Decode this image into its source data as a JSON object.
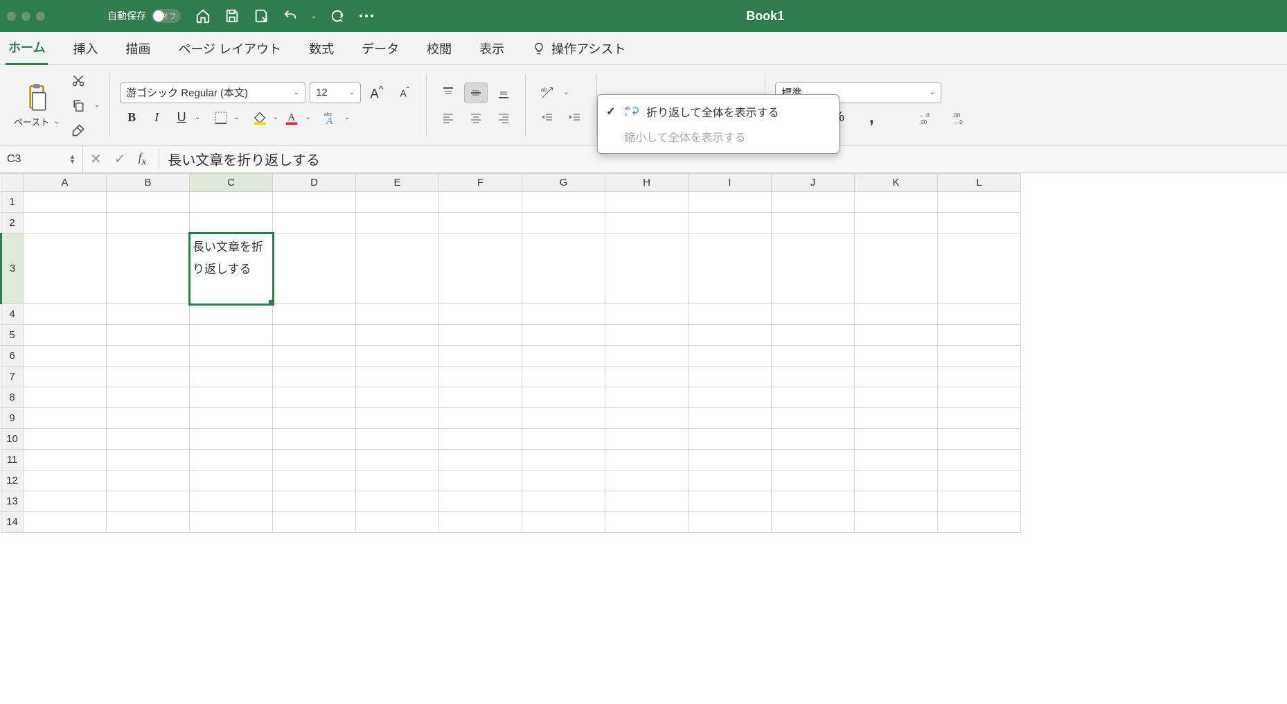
{
  "titlebar": {
    "autosave_label": "自動保存",
    "autosave_toggle": "オフ",
    "title": "Book1"
  },
  "tabs": [
    "ホーム",
    "挿入",
    "描画",
    "ページ レイアウト",
    "数式",
    "データ",
    "校閲",
    "表示"
  ],
  "assist": {
    "label": "操作アシスト"
  },
  "ribbon": {
    "paste_label": "ペースト",
    "font_name": "游ゴシック Regular (本文)",
    "font_size": "12",
    "wrap_label": "折り返して全体を表示する",
    "number_format": "標準"
  },
  "wrap_menu": {
    "item1": "折り返して全体を表示する",
    "item2": "縮小して全体を表示する"
  },
  "namebar": {
    "cell_ref": "C3",
    "formula_value": "長い文章を折り返しする"
  },
  "columns": [
    "A",
    "B",
    "C",
    "D",
    "E",
    "F",
    "G",
    "H",
    "I",
    "J",
    "K",
    "L"
  ],
  "rows": [
    1,
    2,
    3,
    4,
    5,
    6,
    7,
    8,
    9,
    10,
    11,
    12,
    13,
    14
  ],
  "selected": {
    "col": "C",
    "row": 3
  },
  "cells": {
    "C3": "長い文章を折り返しする"
  }
}
